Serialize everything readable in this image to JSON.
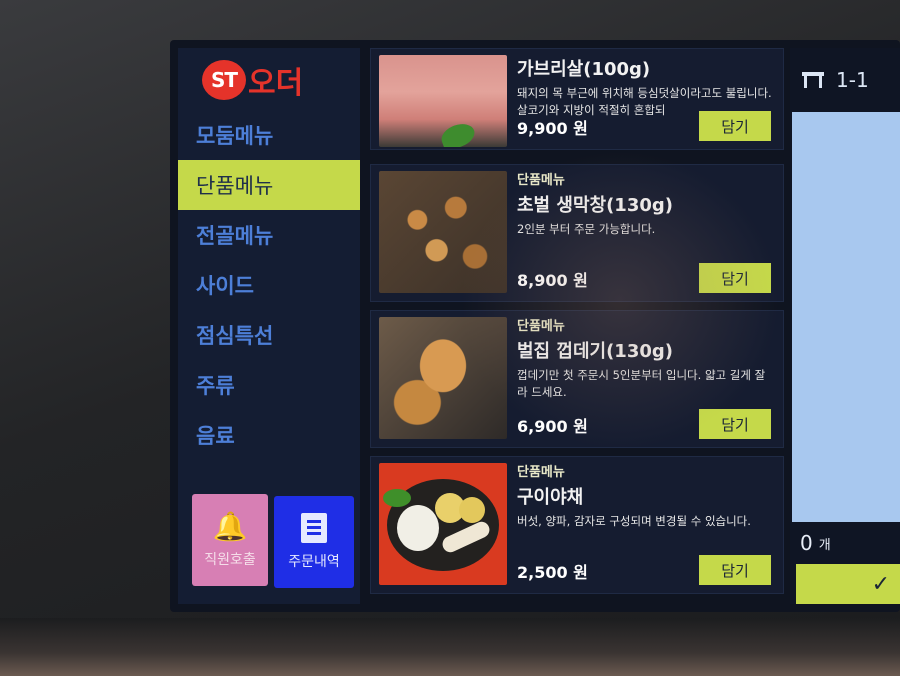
{
  "app": {
    "logo_badge": "ST",
    "logo_text": "오더"
  },
  "sidebar": {
    "items": [
      {
        "label": "모둠메뉴",
        "active": false
      },
      {
        "label": "단품메뉴",
        "active": true
      },
      {
        "label": "전골메뉴",
        "active": false
      },
      {
        "label": "사이드",
        "active": false
      },
      {
        "label": "점심특선",
        "active": false
      },
      {
        "label": "주류",
        "active": false
      },
      {
        "label": "음료",
        "active": false
      }
    ],
    "staff_call_label": "직원호출",
    "order_history_label": "주문내역"
  },
  "menu": {
    "add_label": "담기",
    "items": [
      {
        "category": "",
        "name": "가브리살(100g)",
        "description": "돼지의 목 부근에 위치해 등심덧살이라고도 불립니다. 살코기와 지방이 적절히 혼합되",
        "price": "9,900 원"
      },
      {
        "category": "단품메뉴",
        "name": "초벌 생막창(130g)",
        "description": "2인분 부터 주문 가능합니다.",
        "price": "8,900 원"
      },
      {
        "category": "단품메뉴",
        "name": "벌집 껍데기(130g)",
        "description": "껍데기만 첫 주문시 5인분부터 입니다. 얇고 길게 잘라 드세요.",
        "price": "6,900 원"
      },
      {
        "category": "단품메뉴",
        "name": "구이야채",
        "description": "버섯, 양파, 감자로 구성되며 변경될 수 있습니다.",
        "price": "2,500 원"
      }
    ]
  },
  "cart": {
    "table_label": "1-1",
    "count_value": "0",
    "count_unit": "개",
    "confirm_icon": "check-icon"
  },
  "colors": {
    "accent": "#c5d94a",
    "nav_text": "#4d7fd8",
    "brand_red": "#e5332a",
    "staff_button": "#d77fb4",
    "order_button": "#1f2ee6"
  }
}
